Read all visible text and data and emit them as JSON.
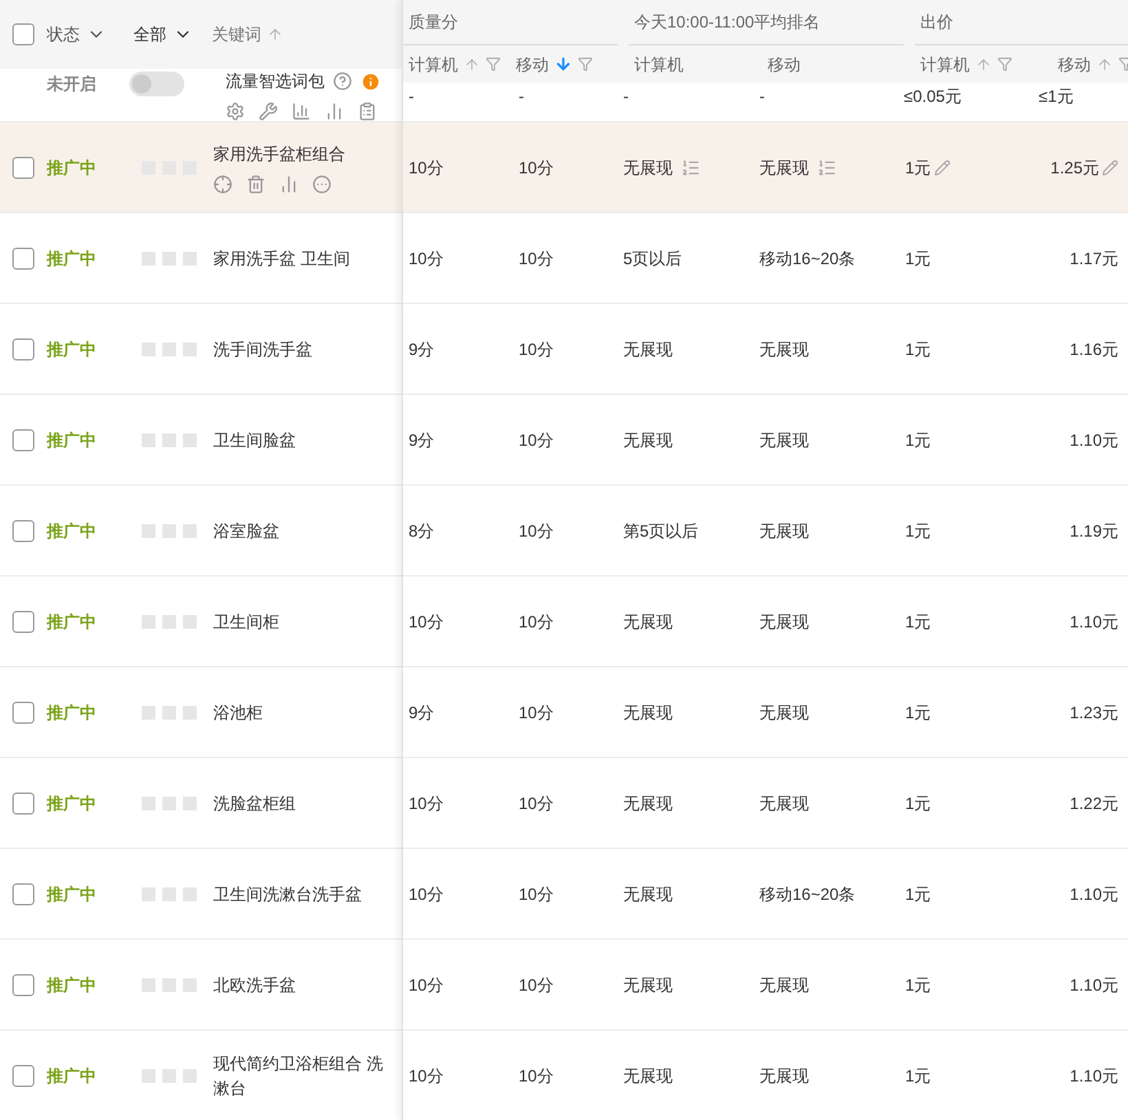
{
  "header": {
    "select_all": {
      "checked": false
    },
    "status": {
      "label": "状态"
    },
    "scope": {
      "label": "全部"
    },
    "keyword": {
      "label": "关键词",
      "sortable": true,
      "ascending": true,
      "active": false
    },
    "groups": [
      {
        "label": "质量分",
        "columns": [
          {
            "label": "计算机",
            "sortable": true,
            "ascending": true,
            "active": false,
            "filter": true
          },
          {
            "label": "移动",
            "sortable": true,
            "ascending": false,
            "active": true,
            "filter": true
          }
        ]
      },
      {
        "label": "今天10:00-11:00平均排名",
        "columns": [
          {
            "label": "计算机",
            "sortable": false,
            "filter": false
          },
          {
            "label": "移动",
            "sortable": false,
            "filter": false
          }
        ]
      },
      {
        "label": "出价",
        "columns": [
          {
            "label": "计算机",
            "sortable": true,
            "ascending": true,
            "active": false,
            "filter": true
          },
          {
            "label": "移动",
            "sortable": true,
            "ascending": true,
            "active": false,
            "filter": true
          }
        ]
      }
    ]
  },
  "package_row": {
    "status": "未开启",
    "on": false,
    "name": "流量智选词包",
    "values": [
      "-",
      "-",
      "-",
      "-",
      "≤0.05元",
      "≤1元"
    ]
  },
  "rows": [
    {
      "checked": false,
      "hovered": true,
      "status": "推广中",
      "keyword": "家用洗手盆柜组合",
      "values": [
        "10分",
        "10分",
        "无展现",
        "无展现",
        "1元",
        "1.25元"
      ]
    },
    {
      "checked": false,
      "hovered": false,
      "status": "推广中",
      "keyword": "家用洗手盆 卫生间",
      "values": [
        "10分",
        "10分",
        "5页以后",
        "移动16~20条",
        "1元",
        "1.17元"
      ]
    },
    {
      "checked": false,
      "hovered": false,
      "status": "推广中",
      "keyword": "洗手间洗手盆",
      "values": [
        "9分",
        "10分",
        "无展现",
        "无展现",
        "1元",
        "1.16元"
      ]
    },
    {
      "checked": false,
      "hovered": false,
      "status": "推广中",
      "keyword": "卫生间脸盆",
      "values": [
        "9分",
        "10分",
        "无展现",
        "无展现",
        "1元",
        "1.10元"
      ]
    },
    {
      "checked": false,
      "hovered": false,
      "status": "推广中",
      "keyword": "浴室脸盆",
      "values": [
        "8分",
        "10分",
        "第5页以后",
        "无展现",
        "1元",
        "1.19元"
      ]
    },
    {
      "checked": false,
      "hovered": false,
      "status": "推广中",
      "keyword": "卫生间柜",
      "values": [
        "10分",
        "10分",
        "无展现",
        "无展现",
        "1元",
        "1.10元"
      ]
    },
    {
      "checked": false,
      "hovered": false,
      "status": "推广中",
      "keyword": "浴池柜",
      "values": [
        "9分",
        "10分",
        "无展现",
        "无展现",
        "1元",
        "1.23元"
      ]
    },
    {
      "checked": false,
      "hovered": false,
      "status": "推广中",
      "keyword": "洗脸盆柜组",
      "values": [
        "10分",
        "10分",
        "无展现",
        "无展现",
        "1元",
        "1.22元"
      ]
    },
    {
      "checked": false,
      "hovered": false,
      "status": "推广中",
      "keyword": "卫生间洗漱台洗手盆",
      "values": [
        "10分",
        "10分",
        "无展现",
        "移动16~20条",
        "1元",
        "1.10元"
      ]
    },
    {
      "checked": false,
      "hovered": false,
      "status": "推广中",
      "keyword": "北欧洗手盆",
      "values": [
        "10分",
        "10分",
        "无展现",
        "无展现",
        "1元",
        "1.10元"
      ]
    },
    {
      "checked": false,
      "hovered": false,
      "status": "推广中",
      "keyword": "现代简约卫浴柜组合 洗漱台",
      "values": [
        "10分",
        "10分",
        "无展现",
        "无展现",
        "1元",
        "1.10元"
      ]
    }
  ]
}
